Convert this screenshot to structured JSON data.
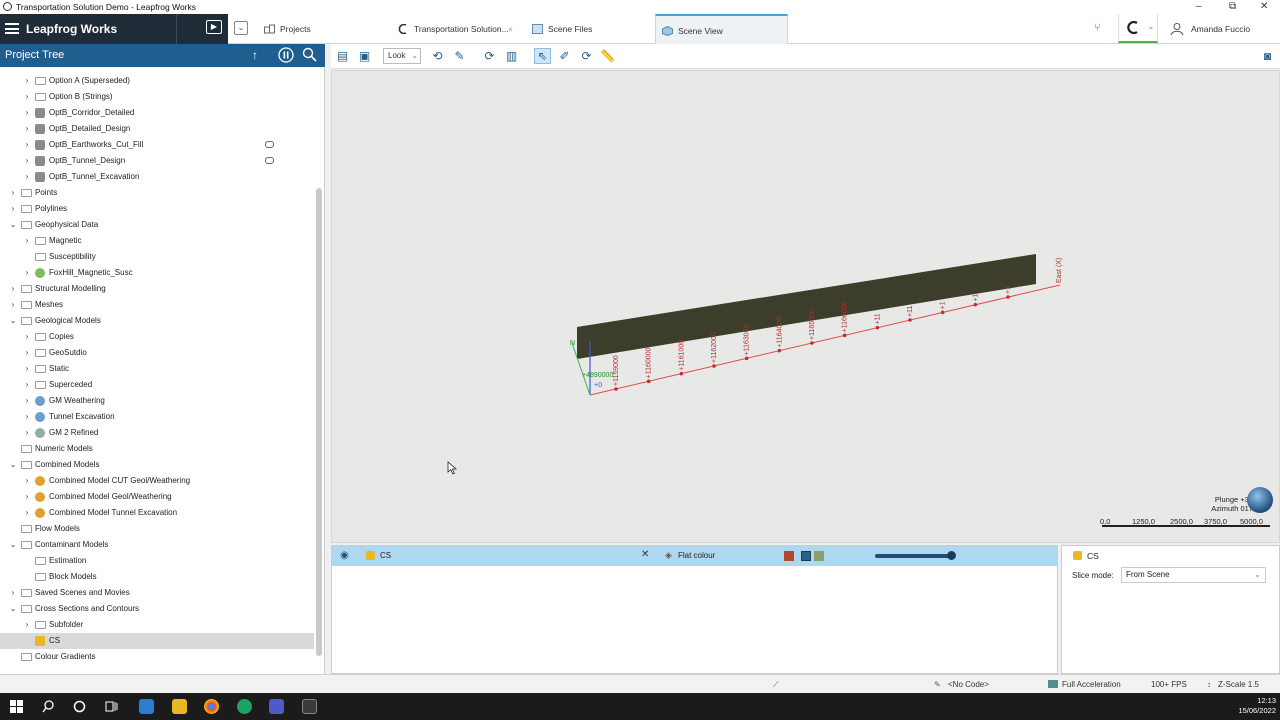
{
  "window": {
    "title": "Transportation Solution Demo - Leapfrog Works",
    "controls": [
      "–",
      "⧉",
      "✕"
    ]
  },
  "app": {
    "brand": "Leapfrog Works",
    "tabs": [
      {
        "label": "Projects",
        "icon": "projects-icon"
      },
      {
        "label": "Transportation Solution...",
        "icon": "leapfrog-icon"
      },
      {
        "label": "Scene Files",
        "icon": "scene-files-icon"
      },
      {
        "label": "Scene View",
        "icon": "scene-view-icon",
        "active": true
      }
    ],
    "user": "Amanda Fuccio"
  },
  "tree": {
    "title": "Project Tree",
    "items": [
      {
        "label": "Option A (Superseded)",
        "level": 2,
        "chev": "›",
        "icon": "folder"
      },
      {
        "label": "Option B (Strings)",
        "level": 2,
        "chev": "›",
        "icon": "folder"
      },
      {
        "label": "OptB_Corridor_Detailed",
        "level": 2,
        "chev": "›",
        "icon": "mesh"
      },
      {
        "label": "OptB_Detailed_Design",
        "level": 2,
        "chev": "›",
        "icon": "mesh"
      },
      {
        "label": "OptB_Earthworks_Cut_Fill",
        "level": 2,
        "chev": "›",
        "icon": "mesh",
        "comment": true
      },
      {
        "label": "OptB_Tunnel_Design",
        "level": 2,
        "chev": "›",
        "icon": "mesh",
        "comment": true
      },
      {
        "label": "OptB_Tunnel_Excavation",
        "level": 2,
        "chev": "›",
        "icon": "mesh"
      },
      {
        "label": "Points",
        "level": 1,
        "chev": "›",
        "icon": "folder"
      },
      {
        "label": "Polylines",
        "level": 1,
        "chev": "›",
        "icon": "folder"
      },
      {
        "label": "Geophysical Data",
        "level": 1,
        "chev": "⌄",
        "icon": "folder"
      },
      {
        "label": "Magnetic",
        "level": 2,
        "chev": "›",
        "icon": "folder"
      },
      {
        "label": "Susceptibility",
        "level": 2,
        "chev": "",
        "icon": "folder"
      },
      {
        "label": "FoxHill_Magnetic_Susc",
        "level": 2,
        "chev": "›",
        "icon": "grid"
      },
      {
        "label": "Structural Modelling",
        "level": 1,
        "chev": "›",
        "icon": "folder"
      },
      {
        "label": "Meshes",
        "level": 1,
        "chev": "›",
        "icon": "folder"
      },
      {
        "label": "Geological Models",
        "level": 1,
        "chev": "⌄",
        "icon": "folder"
      },
      {
        "label": "Copies",
        "level": 2,
        "chev": "›",
        "icon": "folder"
      },
      {
        "label": "GeoSutdio",
        "level": 2,
        "chev": "›",
        "icon": "folder"
      },
      {
        "label": "Static",
        "level": 2,
        "chev": "›",
        "icon": "folder"
      },
      {
        "label": "Superceded",
        "level": 2,
        "chev": "›",
        "icon": "folder"
      },
      {
        "label": "GM Weathering",
        "level": 2,
        "chev": "›",
        "icon": "geomodel"
      },
      {
        "label": "Tunnel Excavation",
        "level": 2,
        "chev": "›",
        "icon": "geomodel"
      },
      {
        "label": "GM 2 Refined",
        "level": 2,
        "chev": "›",
        "icon": "geomodel2"
      },
      {
        "label": "Numeric Models",
        "level": 1,
        "chev": "",
        "icon": "folder"
      },
      {
        "label": "Combined Models",
        "level": 1,
        "chev": "⌄",
        "icon": "folder"
      },
      {
        "label": "Combined Model CUT Geol/Weathering",
        "level": 2,
        "chev": "›",
        "icon": "combined"
      },
      {
        "label": "Combined Model Geol/Weathering",
        "level": 2,
        "chev": "›",
        "icon": "combined"
      },
      {
        "label": "Combined Model Tunnel Excavation",
        "level": 2,
        "chev": "›",
        "icon": "combined"
      },
      {
        "label": "Flow Models",
        "level": 1,
        "chev": "",
        "icon": "folder"
      },
      {
        "label": "Contaminant Models",
        "level": 1,
        "chev": "⌄",
        "icon": "folder"
      },
      {
        "label": "Estimation",
        "level": 2,
        "chev": "",
        "icon": "folder"
      },
      {
        "label": "Block Models",
        "level": 2,
        "chev": "",
        "icon": "folder"
      },
      {
        "label": "Saved Scenes and Movies",
        "level": 1,
        "chev": "›",
        "icon": "folder"
      },
      {
        "label": "Cross Sections and Contours",
        "level": 1,
        "chev": "⌄",
        "icon": "folder"
      },
      {
        "label": "Subfolder",
        "level": 2,
        "chev": "›",
        "icon": "folder"
      },
      {
        "label": "CS",
        "level": 2,
        "chev": "",
        "icon": "section",
        "selected": true
      },
      {
        "label": "Colour Gradients",
        "level": 1,
        "chev": "",
        "icon": "folder"
      }
    ]
  },
  "toolbar": {
    "look_label": "Look"
  },
  "scene": {
    "origin_label_1": "+4890000",
    "origin_label_2": "+0",
    "north_label": "N",
    "east_label": "East (X)",
    "tick_labels": [
      "+1159000",
      "+1160000",
      "+1161000",
      "+1162000",
      "+1163000",
      "+1164000",
      "+1165000",
      "+1166000",
      "+11",
      "+11",
      "+1",
      "+1",
      "+1"
    ],
    "plunge": "Plunge +39",
    "azimuth": "Azimuth 017",
    "scale_ticks": [
      "0,0",
      "1250,0",
      "2500,0",
      "3750,0",
      "5000,0"
    ]
  },
  "shapes": {
    "row_label": "CS",
    "colour_mode": "Flat colour",
    "swatches": [
      "#b04a2a",
      "#2a5f88",
      "#8aa06a"
    ]
  },
  "properties": {
    "title": "CS",
    "slice_mode_label": "Slice mode:",
    "slice_mode_value": "From Scene"
  },
  "status": {
    "code": "<No Code>",
    "acceleration": "Full Acceleration",
    "fps": "100+ FPS",
    "zscale": "Z-Scale 1.5"
  },
  "taskbar": {
    "time": "12:13",
    "date": "15/06/2022"
  }
}
